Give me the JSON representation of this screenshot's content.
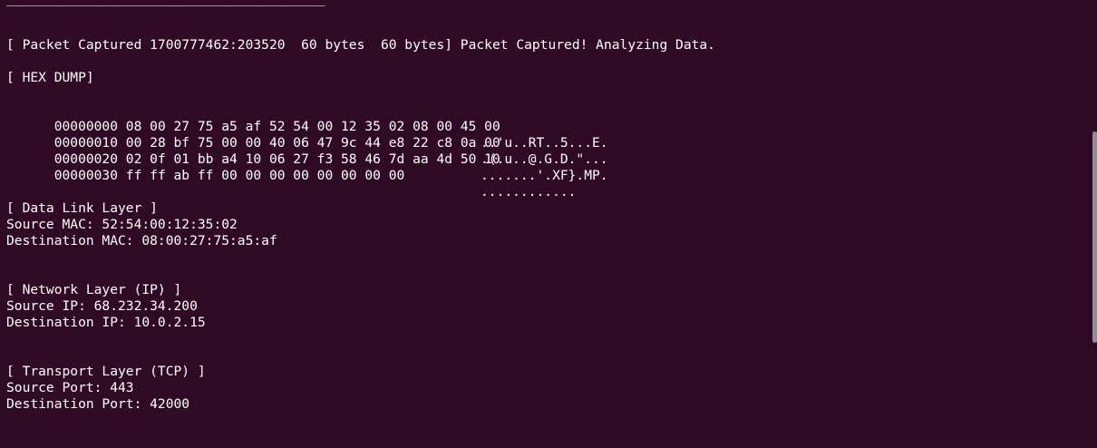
{
  "separator": "________________________________________",
  "capture_line": "[ Packet Captured 1700777462:203520  60 bytes  60 bytes] Packet Captured! Analyzing Data.",
  "hex_dump": {
    "title": "[ HEX DUMP]",
    "rows": [
      {
        "offset_hex": "00000000 08 00 27 75 a5 af 52 54 00 12 35 02 08 00 45 00",
        "ascii": "..'u..RT..5...E."
      },
      {
        "offset_hex": "00000010 00 28 bf 75 00 00 40 06 47 9c 44 e8 22 c8 0a 00",
        "ascii": ".(.u..@.G.D.\"..."
      },
      {
        "offset_hex": "00000020 02 0f 01 bb a4 10 06 27 f3 58 46 7d aa 4d 50 10",
        "ascii": ".......'.XF}.MP."
      },
      {
        "offset_hex": "00000030 ff ff ab ff 00 00 00 00 00 00 00 00",
        "ascii": "............"
      }
    ]
  },
  "data_link": {
    "title": "[ Data Link Layer ]",
    "source_mac": "Source MAC: 52:54:00:12:35:02",
    "dest_mac": "Destination MAC: 08:00:27:75:a5:af"
  },
  "network": {
    "title": "[ Network Layer (IP) ]",
    "source_ip": "Source IP: 68.232.34.200",
    "dest_ip": "Destination IP: 10.0.2.15"
  },
  "transport": {
    "title": "[ Transport Layer (TCP) ]",
    "source_port": "Source Port: 443",
    "dest_port": "Destination Port: 42000"
  },
  "colors": {
    "background": "#300a24",
    "text": "#ffffff",
    "scrollbar": "#8f8f8f"
  }
}
